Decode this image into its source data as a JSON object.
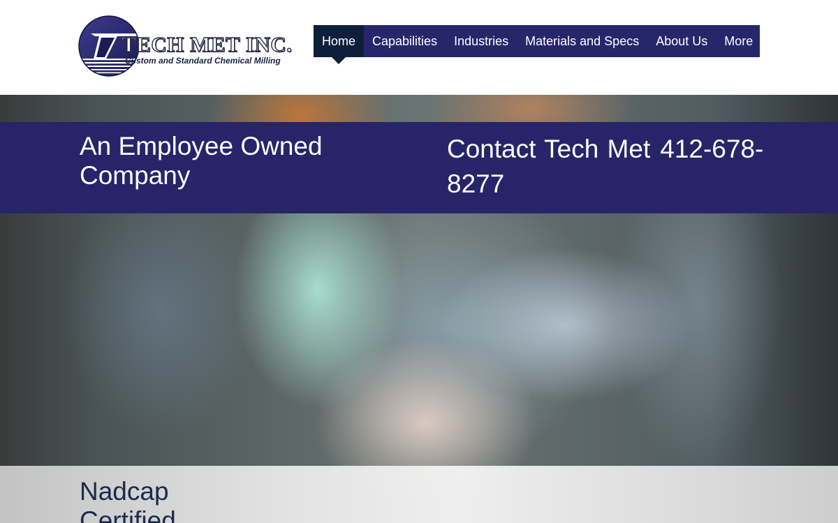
{
  "colors": {
    "nav_background": "#26266b",
    "nav_active": "#0e1f3a",
    "banner_background": "#27246a",
    "logo_navy": "#2a2b45"
  },
  "logo": {
    "name": "TECH MET INC.",
    "tagline": "Custom and Standard Chemical Milling",
    "icon": "techmet-globe-logo-icon"
  },
  "nav": {
    "items": [
      {
        "label": "Home",
        "active": true
      },
      {
        "label": "Capabilities",
        "active": false
      },
      {
        "label": "Industries",
        "active": false
      },
      {
        "label": "Materials and Specs",
        "active": false
      },
      {
        "label": "About Us",
        "active": false
      },
      {
        "label": "More",
        "active": false
      }
    ]
  },
  "banner": {
    "left_text": "An Employee Owned Company",
    "contact_label": "Contact Tech Met",
    "contact_phone": "412-678-8277"
  },
  "certification": {
    "text": "Nadcap Certified"
  }
}
